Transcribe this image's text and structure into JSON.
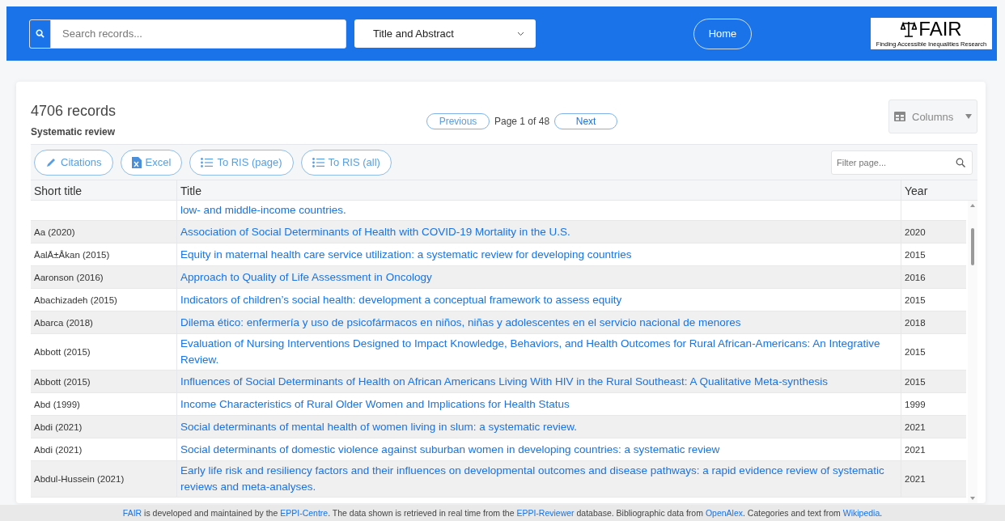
{
  "header": {
    "search": {
      "placeholder": "Search records..."
    },
    "field_select": {
      "value": "Title and Abstract"
    },
    "home_button": "Home",
    "logo": {
      "title": "FAIR",
      "subtitle": "Finding Accessible Inequalities Research"
    }
  },
  "results": {
    "count": "4706 records",
    "filter_label": "Systematic review",
    "pagination": {
      "previous": "Previous",
      "page_info": "Page 1 of 48",
      "next": "Next"
    },
    "columns_button": "Columns",
    "export_buttons": [
      {
        "kind": "citations",
        "label": "Citations"
      },
      {
        "kind": "excel",
        "label": "Excel"
      },
      {
        "kind": "ris",
        "label": "To RIS (page)"
      },
      {
        "kind": "ris",
        "label": "To RIS (all)"
      }
    ],
    "filter": {
      "placeholder": "Filter page..."
    },
    "table": {
      "columns": [
        "Short title",
        "Title",
        "Year"
      ],
      "rows": [
        {
          "short_title": "",
          "title": "low- and middle-income countries.",
          "year": "",
          "partial": true
        },
        {
          "short_title": "Aa (2020)",
          "title": "Association of Social Determinants of Health with COVID-19 Mortality in the U.S.",
          "year": "2020"
        },
        {
          "short_title": "ĀalĀ±Åkan (2015)",
          "title": "Equity in maternal health care service utilization: a systematic review for developing countries",
          "year": "2015"
        },
        {
          "short_title": "Aaronson (2016)",
          "title": "Approach to Quality of Life Assessment in Oncology",
          "year": "2016"
        },
        {
          "short_title": "Abachizadeh (2015)",
          "title": "Indicators of children’s social health: development a conceptual framework to assess equity",
          "year": "2015"
        },
        {
          "short_title": "Abarca (2018)",
          "title": "Dilema ético: enfermería y uso de psicofármacos en niños, niñas y adolescentes en el servicio nacional de menores",
          "year": "2018"
        },
        {
          "short_title": "Abbott (2015)",
          "title": "Evaluation of Nursing Interventions Designed to Impact Knowledge, Behaviors, and Health Outcomes for Rural African-Americans: An Integrative Review.",
          "year": "2015"
        },
        {
          "short_title": "Abbott (2015)",
          "title": "Influences of Social Determinants of Health on African Americans Living With HIV in the Rural Southeast: A Qualitative Meta-synthesis",
          "year": "2015"
        },
        {
          "short_title": "Abd (1999)",
          "title": "Income Characteristics of Rural Older Women and Implications for Health Status",
          "year": "1999"
        },
        {
          "short_title": "Abdi (2021)",
          "title": "Social determinants of mental health of women living in slum: a systematic review.",
          "year": "2021"
        },
        {
          "short_title": "Abdi (2021)",
          "title": "Social determinants of domestic violence against suburban women in developing countries: a systematic review",
          "year": "2021"
        },
        {
          "short_title": "Abdul-Hussein (2021)",
          "title": "Early life risk and resiliency factors and their influences on developmental outcomes and disease pathways: a rapid evidence review of systematic reviews and meta-analyses.",
          "year": "2021"
        }
      ]
    }
  },
  "footer": [
    {
      "text": "FAIR",
      "link": true
    },
    {
      "text": " is developed and maintained by the ",
      "link": false
    },
    {
      "text": "EPPI-Centre",
      "link": true
    },
    {
      "text": ". The data shown is retrieved in real time from the ",
      "link": false
    },
    {
      "text": "EPPI-Reviewer",
      "link": true
    },
    {
      "text": " database. Bibliographic data from ",
      "link": false
    },
    {
      "text": "OpenAlex",
      "link": true
    },
    {
      "text": ". Categories and text from ",
      "link": false
    },
    {
      "text": "Wikipedia",
      "link": true
    },
    {
      "text": ".",
      "link": false
    }
  ]
}
